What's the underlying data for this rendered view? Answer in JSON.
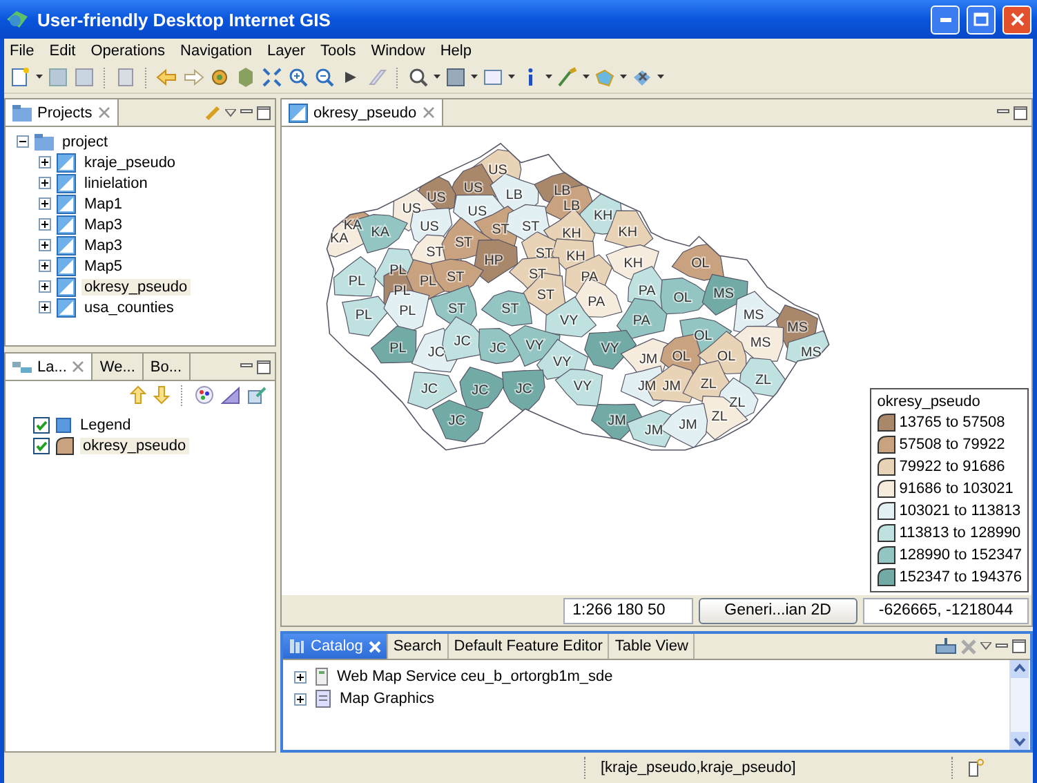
{
  "window": {
    "title": "User-friendly Desktop Internet GIS"
  },
  "menu": [
    "File",
    "Edit",
    "Operations",
    "Navigation",
    "Layer",
    "Tools",
    "Window",
    "Help"
  ],
  "projects_view": {
    "tab": "Projects",
    "tree": {
      "label": "project",
      "expanded": true,
      "children": [
        {
          "label": "kraje_pseudo",
          "expanded": false,
          "selected": false
        },
        {
          "label": "linielation",
          "expanded": false,
          "selected": false
        },
        {
          "label": "Map1",
          "expanded": false,
          "selected": false
        },
        {
          "label": "Map3",
          "expanded": false,
          "selected": false
        },
        {
          "label": "Map3",
          "expanded": false,
          "selected": false
        },
        {
          "label": "Map5",
          "expanded": false,
          "selected": false
        },
        {
          "label": "okresy_pseudo",
          "expanded": false,
          "selected": true
        },
        {
          "label": "usa_counties",
          "expanded": false,
          "selected": false
        }
      ]
    }
  },
  "layers_view": {
    "tabs": [
      {
        "label": "La...",
        "selected": true
      },
      {
        "label": "We...",
        "selected": false
      },
      {
        "label": "Bo...",
        "selected": false
      }
    ],
    "layers": [
      {
        "label": "Legend",
        "kind": "legend",
        "checked": true,
        "selected": false
      },
      {
        "label": "okresy_pseudo",
        "kind": "polygon",
        "checked": true,
        "selected": true
      }
    ]
  },
  "editor": {
    "tab": "okresy_pseudo",
    "map": {
      "districts": [
        {
          "label": "US",
          "color": "#e9d3b6"
        },
        {
          "label": "US",
          "color": "#a9876a"
        },
        {
          "label": "US",
          "color": "#a9876a"
        },
        {
          "label": "US",
          "color": "#f6ecdd"
        },
        {
          "label": "LB",
          "color": "#e3f0f3"
        },
        {
          "label": "US",
          "color": "#e3f0f3"
        },
        {
          "label": "LB",
          "color": "#a9876a"
        },
        {
          "label": "LB",
          "color": "#c9a27f"
        },
        {
          "label": "KH",
          "color": "#bfe1df"
        },
        {
          "label": "KH",
          "color": "#e9d3b6"
        },
        {
          "label": "KA",
          "color": "#c9a27f"
        },
        {
          "label": "KA",
          "color": "#f6ecdd"
        },
        {
          "label": "KA",
          "color": "#93c6c2"
        },
        {
          "label": "US",
          "color": "#e3f0f3"
        },
        {
          "label": "ST",
          "color": "#c9a27f"
        },
        {
          "label": "ST",
          "color": "#e3f0f3"
        },
        {
          "label": "KH",
          "color": "#e9d3b6"
        },
        {
          "label": "ST",
          "color": "#f6ecdd"
        },
        {
          "label": "ST",
          "color": "#c9a27f"
        },
        {
          "label": "HP",
          "color": "#a9876a"
        },
        {
          "label": "ST",
          "color": "#e9d3b6"
        },
        {
          "label": "KH",
          "color": "#e9d3b6"
        },
        {
          "label": "KH",
          "color": "#f6ecdd"
        },
        {
          "label": "OL",
          "color": "#c9a27f"
        },
        {
          "label": "PL",
          "color": "#bfe1df"
        },
        {
          "label": "PL",
          "color": "#bfe1df"
        },
        {
          "label": "PL",
          "color": "#a9876a"
        },
        {
          "label": "PL",
          "color": "#c9a27f"
        },
        {
          "label": "ST",
          "color": "#c9a27f"
        },
        {
          "label": "ST",
          "color": "#e9d3b6"
        },
        {
          "label": "PA",
          "color": "#e9d3b6"
        },
        {
          "label": "ST",
          "color": "#e9d3b6"
        },
        {
          "label": "PA",
          "color": "#bfe1df"
        },
        {
          "label": "PA",
          "color": "#f6ecdd"
        },
        {
          "label": "OL",
          "color": "#93c6c2"
        },
        {
          "label": "MS",
          "color": "#72aaa6"
        },
        {
          "label": "PL",
          "color": "#bfe1df"
        },
        {
          "label": "PL",
          "color": "#e3f0f3"
        },
        {
          "label": "ST",
          "color": "#93c6c2"
        },
        {
          "label": "ST",
          "color": "#93c6c2"
        },
        {
          "label": "VY",
          "color": "#bfe1df"
        },
        {
          "label": "PA",
          "color": "#93c6c2"
        },
        {
          "label": "MS",
          "color": "#e3f0f3"
        },
        {
          "label": "MS",
          "color": "#a9876a"
        },
        {
          "label": "OL",
          "color": "#93c6c2"
        },
        {
          "label": "MS",
          "color": "#f6ecdd"
        },
        {
          "label": "MS",
          "color": "#bfe1df"
        },
        {
          "label": "PL",
          "color": "#72aaa6"
        },
        {
          "label": "JC",
          "color": "#e3f0f3"
        },
        {
          "label": "JC",
          "color": "#bfe1df"
        },
        {
          "label": "JC",
          "color": "#93c6c2"
        },
        {
          "label": "VY",
          "color": "#93c6c2"
        },
        {
          "label": "VY",
          "color": "#72aaa6"
        },
        {
          "label": "JM",
          "color": "#f6ecdd"
        },
        {
          "label": "OL",
          "color": "#c9a27f"
        },
        {
          "label": "OL",
          "color": "#e9d3b6"
        },
        {
          "label": "ZL",
          "color": "#bfe1df"
        },
        {
          "label": "VY",
          "color": "#bfe1df"
        },
        {
          "label": "JC",
          "color": "#bfe1df"
        },
        {
          "label": "JC",
          "color": "#72aaa6"
        },
        {
          "label": "JC",
          "color": "#72aaa6"
        },
        {
          "label": "VY",
          "color": "#bfe1df"
        },
        {
          "label": "JM",
          "color": "#e3f0f3"
        },
        {
          "label": "JM",
          "color": "#e9d3b6"
        },
        {
          "label": "ZL",
          "color": "#e9d3b6"
        },
        {
          "label": "ZL",
          "color": "#e3f0f3"
        },
        {
          "label": "ZL",
          "color": "#f6ecdd"
        },
        {
          "label": "JC",
          "color": "#72aaa6"
        },
        {
          "label": "JM",
          "color": "#72aaa6"
        },
        {
          "label": "JM",
          "color": "#bfe1df"
        },
        {
          "label": "JM",
          "color": "#e3f0f3"
        }
      ]
    },
    "legend": {
      "title": "okresy_pseudo",
      "items": [
        {
          "label": "13765 to 57508",
          "color": "#a9876a"
        },
        {
          "label": "57508 to 79922",
          "color": "#c9a27f"
        },
        {
          "label": "79922 to 91686",
          "color": "#e9d3b6"
        },
        {
          "label": "91686 to 103021",
          "color": "#f6ecdd"
        },
        {
          "label": "103021 to 113813",
          "color": "#e3f0f3"
        },
        {
          "label": "113813 to 128990",
          "color": "#bfe1df"
        },
        {
          "label": "128990 to 152347",
          "color": "#93c6c2"
        },
        {
          "label": "152347 to 194376",
          "color": "#72aaa6"
        }
      ]
    }
  },
  "map_status": {
    "scale": "1:266 180 50",
    "crs": "Generi...ian 2D",
    "coordinates": "-626665, -1218044"
  },
  "catalog_view": {
    "tabs": [
      {
        "label": "Catalog",
        "selected": true
      },
      {
        "label": "Search",
        "selected": false
      },
      {
        "label": "Default Feature Editor",
        "selected": false
      },
      {
        "label": "Table View",
        "selected": false
      }
    ],
    "items": [
      {
        "label": "Web Map Service ceu_b_ortorgb1m_sde",
        "kind": "wms"
      },
      {
        "label": "Map Graphics",
        "kind": "graphics"
      }
    ]
  },
  "status_bar": {
    "text": "[kraje_pseudo,kraje_pseudo]"
  }
}
